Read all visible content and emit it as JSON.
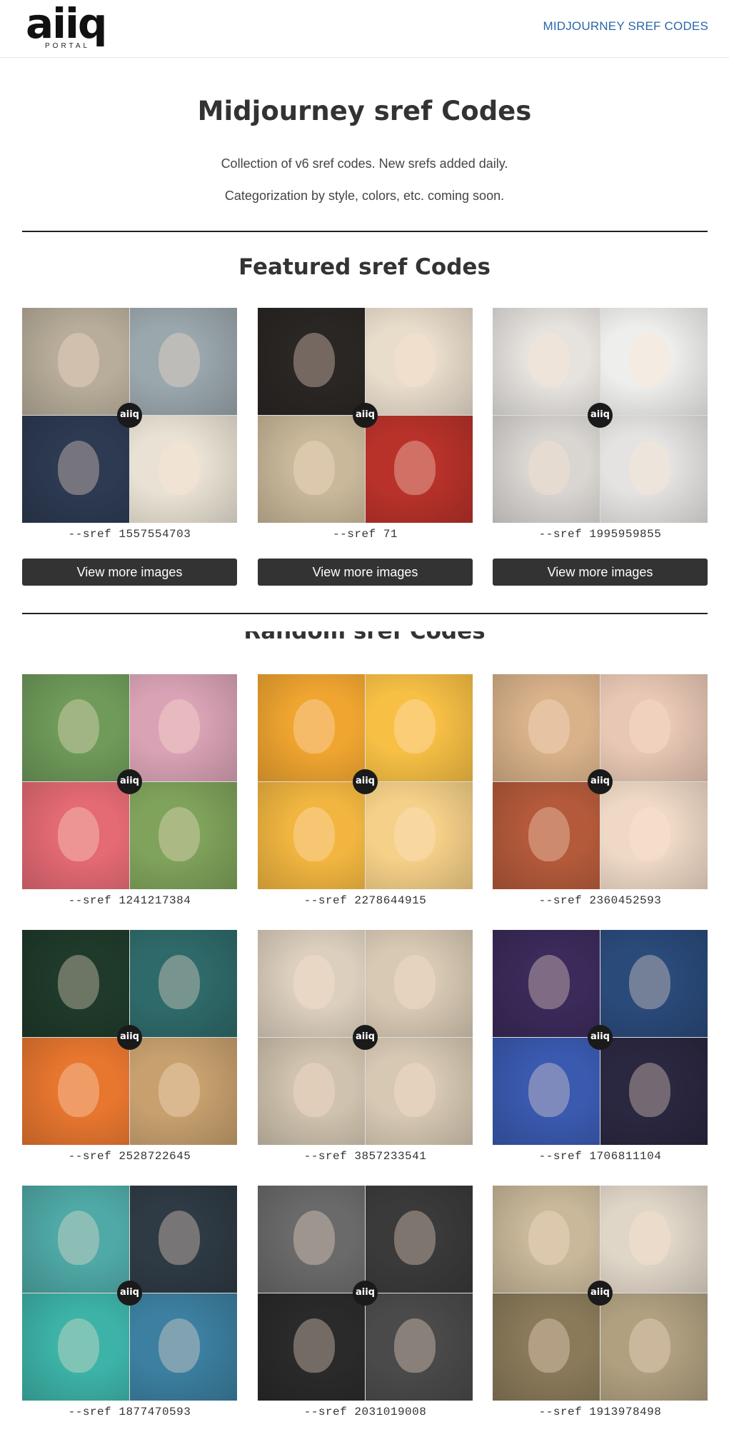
{
  "header": {
    "logo_text": "aiiq",
    "logo_sub": "PORTAL",
    "nav_link": "MIDJOURNEY SREF CODES"
  },
  "hero": {
    "title": "Midjourney sref Codes",
    "line1": "Collection of v6 sref codes. New srefs added daily.",
    "line2": "Categorization by style, colors, etc. coming soon."
  },
  "featured": {
    "title": "Featured sref Codes",
    "button_label": "View more images",
    "cards": [
      {
        "code": "--sref 1557554703",
        "colors": [
          "#b8ad9a",
          "#9aa7ad",
          "#2d3a52",
          "#e9e2d4"
        ],
        "badge": "aiiq"
      },
      {
        "code": "--sref 71",
        "colors": [
          "#2a2624",
          "#e8dccb",
          "#c9b89a",
          "#b8322a"
        ],
        "badge": "aiiq"
      },
      {
        "code": "--sref 1995959855",
        "colors": [
          "#e6e3df",
          "#eeeeec",
          "#d9d6d2",
          "#e4e3e1"
        ],
        "badge": "aiiq"
      }
    ]
  },
  "random": {
    "title": "Random sref Codes",
    "cards": [
      {
        "code": "--sref 1241217384",
        "colors": [
          "#6f9a5a",
          "#d9a3b5",
          "#e46a74",
          "#7fa35b"
        ],
        "badge": "aiiq"
      },
      {
        "code": "--sref 2278644915",
        "colors": [
          "#f0a530",
          "#f7c045",
          "#f2b640",
          "#f5d088"
        ],
        "badge": "aiiq"
      },
      {
        "code": "--sref 2360452593",
        "colors": [
          "#d9b28a",
          "#e8c7b4",
          "#b45a3a",
          "#efd9c6"
        ],
        "badge": "aiiq"
      },
      {
        "code": "--sref 2528722645",
        "colors": [
          "#1f3a2a",
          "#2f6a6a",
          "#e7762f",
          "#c7a06e"
        ],
        "badge": "aiiq"
      },
      {
        "code": "--sref 3857233541",
        "colors": [
          "#dccfbe",
          "#d8c9b4",
          "#cfc2ae",
          "#d6c8b3"
        ],
        "badge": "aiiq"
      },
      {
        "code": "--sref 1706811104",
        "colors": [
          "#3b2a5a",
          "#2a4a7a",
          "#3a5ab0",
          "#2a2740"
        ],
        "badge": "aiiq"
      },
      {
        "code": "--sref 1877470593",
        "colors": [
          "#4fa9a6",
          "#2e3a44",
          "#3db3a8",
          "#3c7fa0"
        ],
        "badge": "aiiq"
      },
      {
        "code": "--sref 2031019008",
        "colors": [
          "#6a6a6a",
          "#3a3a3a",
          "#2a2a2a",
          "#4a4a4a"
        ],
        "badge": "aiiq"
      },
      {
        "code": "--sref 1913978498",
        "colors": [
          "#c9b89a",
          "#e0d6c8",
          "#8a7a5a",
          "#b0a080"
        ],
        "badge": "aiiq"
      }
    ]
  }
}
